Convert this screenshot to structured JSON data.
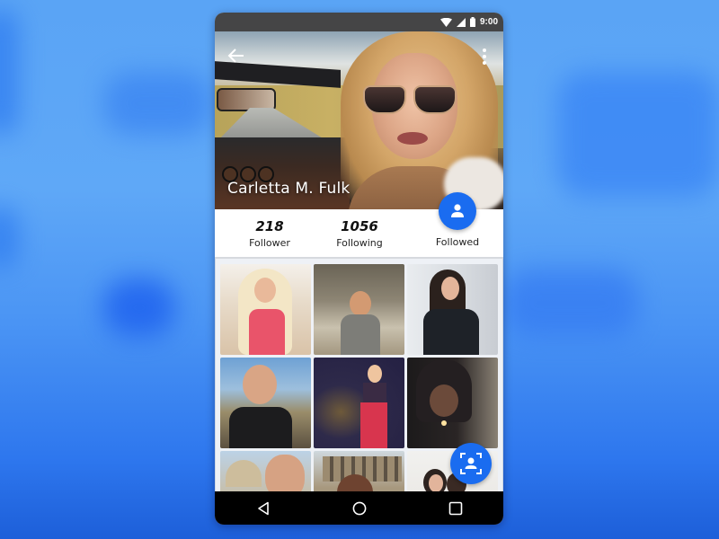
{
  "status_bar": {
    "time": "9:00",
    "icons": [
      "wifi-icon",
      "cell-signal-icon",
      "battery-icon"
    ]
  },
  "toolbar": {
    "back_icon": "arrow-back-icon",
    "menu_icon": "more-vert-icon"
  },
  "profile": {
    "name": "Carletta M. Fulk",
    "stats": [
      {
        "value": "218",
        "label": "Follower"
      },
      {
        "value": "1056",
        "label": "Following"
      }
    ],
    "follow_button": {
      "icon": "person-icon",
      "label": "Followed"
    }
  },
  "photo_grid": {
    "photos": [
      {
        "description": "Blonde woman in pink dress"
      },
      {
        "description": "Smiling man selfie on rocks"
      },
      {
        "description": "Dark-haired woman on phone"
      },
      {
        "description": "Man selfie on mountain"
      },
      {
        "description": "Woman in red skirt at night"
      },
      {
        "description": "Hooded man lighting cigarette"
      },
      {
        "description": "Man selfie in front of domed building"
      },
      {
        "description": "Woman selfie at Colosseum"
      },
      {
        "description": "Two women taking selfie"
      }
    ]
  },
  "fab": {
    "icon": "face-scan-icon"
  },
  "nav_bar": {
    "buttons": [
      "back-triangle-icon",
      "home-circle-icon",
      "recents-square-icon"
    ]
  },
  "colors": {
    "accent": "#1a6cf0",
    "background": "#5aa4f5",
    "grid_background": "#eef1f6",
    "nav_bar": "#000000"
  }
}
